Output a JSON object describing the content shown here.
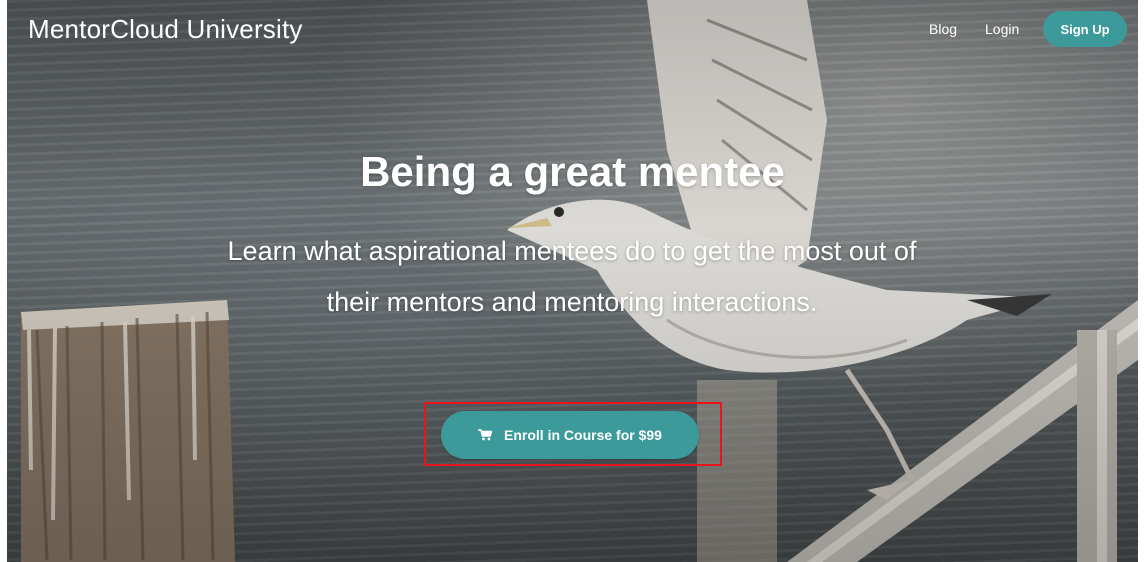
{
  "navbar": {
    "brand": "MentorCloud University",
    "links": {
      "blog": "Blog",
      "login": "Login"
    },
    "signup_label": "Sign Up"
  },
  "hero": {
    "headline": "Being a great mentee",
    "subheadline": "Learn what aspirational mentees do to get the most out of their mentors and mentoring interactions.",
    "cta_label": "Enroll in Course for $99",
    "cta_icon": "shopping-cart-icon",
    "background_image": "seagull-on-railing-photo"
  },
  "colors": {
    "accent": "#3d9a9b",
    "highlight_box": "#e8151e",
    "text": "#ffffff"
  }
}
